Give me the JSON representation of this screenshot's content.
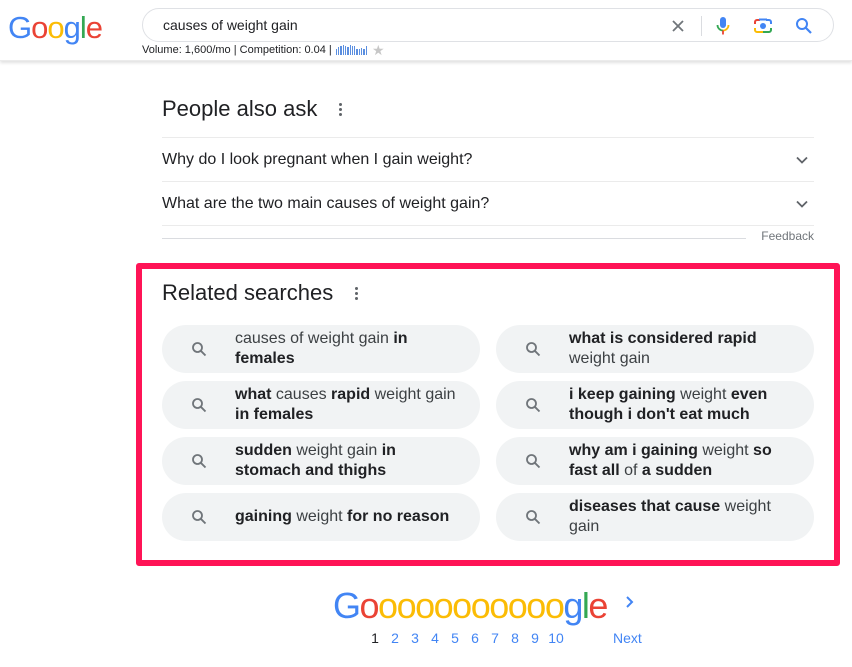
{
  "header": {
    "logo_letters": [
      "G",
      "o",
      "o",
      "g",
      "l",
      "e"
    ],
    "search": {
      "value": "causes of weight gain",
      "placeholder": ""
    },
    "volume_text": "Volume: 1,600/mo | Competition: 0.04 |",
    "trend_bars": [
      0.6,
      0.8,
      0.9,
      1.0,
      0.9,
      0.8,
      1.0,
      0.9,
      0.9,
      0.6,
      0.6,
      0.7,
      0.6,
      0.9
    ],
    "icons": [
      "clear-icon",
      "mic-icon",
      "camera-lens-icon",
      "search-icon"
    ],
    "star_glyph": "★"
  },
  "people_also_ask": {
    "title": "People also ask",
    "questions": [
      "Why do I look pregnant when I gain weight?",
      "What are the two main causes of weight gain?"
    ],
    "feedback_label": "Feedback"
  },
  "related_searches": {
    "title": "Related searches",
    "highlight_color": "#ff1456",
    "items": [
      [
        {
          "t": "causes of weight gain ",
          "b": false
        },
        {
          "t": "in females",
          "b": true
        }
      ],
      [
        {
          "t": "what is considered rapid",
          "b": true
        },
        {
          "t": " weight gain",
          "b": false
        }
      ],
      [
        {
          "t": "what",
          "b": true
        },
        {
          "t": " causes ",
          "b": false
        },
        {
          "t": "rapid",
          "b": true
        },
        {
          "t": " weight gain ",
          "b": false
        },
        {
          "t": "in females",
          "b": true
        }
      ],
      [
        {
          "t": "i keep gaining",
          "b": true
        },
        {
          "t": " weight ",
          "b": false
        },
        {
          "t": "even though i don't eat much",
          "b": true
        }
      ],
      [
        {
          "t": "sudden",
          "b": true
        },
        {
          "t": " weight gain ",
          "b": false
        },
        {
          "t": "in stomach and thighs",
          "b": true
        }
      ],
      [
        {
          "t": "why am i gaining",
          "b": true
        },
        {
          "t": " weight ",
          "b": false
        },
        {
          "t": "so fast all",
          "b": true
        },
        {
          "t": " of ",
          "b": false
        },
        {
          "t": "a sudden",
          "b": true
        }
      ],
      [
        {
          "t": "gaining",
          "b": true
        },
        {
          "t": " weight ",
          "b": false
        },
        {
          "t": "for no reason",
          "b": true
        }
      ],
      [
        {
          "t": "diseases that cause",
          "b": true
        },
        {
          "t": " weight gain",
          "b": false
        }
      ]
    ]
  },
  "pagination": {
    "logo": {
      "first": "G",
      "o_red": "o",
      "o_yellow_count": 10,
      "tail": [
        "g",
        "l",
        "e"
      ]
    },
    "pages": [
      "1",
      "2",
      "3",
      "4",
      "5",
      "6",
      "7",
      "8",
      "9",
      "10"
    ],
    "current_page": "1",
    "next_label": "Next"
  },
  "colors": {
    "blue": "#4285f4",
    "red": "#ea4335",
    "yellow": "#fbbc05",
    "green": "#34a853"
  }
}
